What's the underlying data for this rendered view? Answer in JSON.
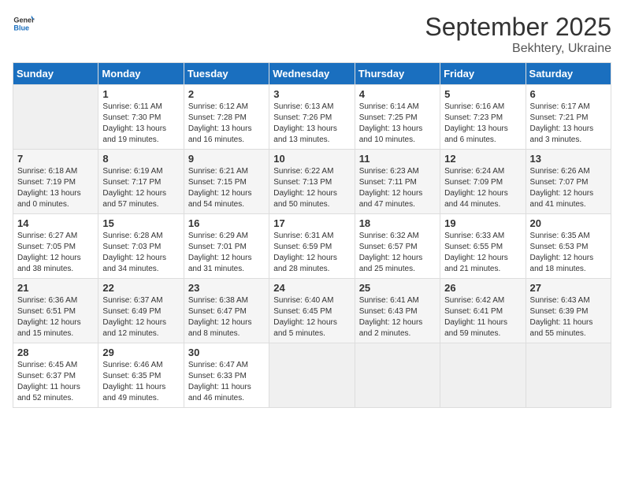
{
  "header": {
    "logo_general": "General",
    "logo_blue": "Blue",
    "month_title": "September 2025",
    "location": "Bekhtery, Ukraine"
  },
  "day_headers": [
    "Sunday",
    "Monday",
    "Tuesday",
    "Wednesday",
    "Thursday",
    "Friday",
    "Saturday"
  ],
  "weeks": [
    [
      {
        "day": "",
        "info": ""
      },
      {
        "day": "1",
        "info": "Sunrise: 6:11 AM\nSunset: 7:30 PM\nDaylight: 13 hours\nand 19 minutes."
      },
      {
        "day": "2",
        "info": "Sunrise: 6:12 AM\nSunset: 7:28 PM\nDaylight: 13 hours\nand 16 minutes."
      },
      {
        "day": "3",
        "info": "Sunrise: 6:13 AM\nSunset: 7:26 PM\nDaylight: 13 hours\nand 13 minutes."
      },
      {
        "day": "4",
        "info": "Sunrise: 6:14 AM\nSunset: 7:25 PM\nDaylight: 13 hours\nand 10 minutes."
      },
      {
        "day": "5",
        "info": "Sunrise: 6:16 AM\nSunset: 7:23 PM\nDaylight: 13 hours\nand 6 minutes."
      },
      {
        "day": "6",
        "info": "Sunrise: 6:17 AM\nSunset: 7:21 PM\nDaylight: 13 hours\nand 3 minutes."
      }
    ],
    [
      {
        "day": "7",
        "info": "Sunrise: 6:18 AM\nSunset: 7:19 PM\nDaylight: 13 hours\nand 0 minutes."
      },
      {
        "day": "8",
        "info": "Sunrise: 6:19 AM\nSunset: 7:17 PM\nDaylight: 12 hours\nand 57 minutes."
      },
      {
        "day": "9",
        "info": "Sunrise: 6:21 AM\nSunset: 7:15 PM\nDaylight: 12 hours\nand 54 minutes."
      },
      {
        "day": "10",
        "info": "Sunrise: 6:22 AM\nSunset: 7:13 PM\nDaylight: 12 hours\nand 50 minutes."
      },
      {
        "day": "11",
        "info": "Sunrise: 6:23 AM\nSunset: 7:11 PM\nDaylight: 12 hours\nand 47 minutes."
      },
      {
        "day": "12",
        "info": "Sunrise: 6:24 AM\nSunset: 7:09 PM\nDaylight: 12 hours\nand 44 minutes."
      },
      {
        "day": "13",
        "info": "Sunrise: 6:26 AM\nSunset: 7:07 PM\nDaylight: 12 hours\nand 41 minutes."
      }
    ],
    [
      {
        "day": "14",
        "info": "Sunrise: 6:27 AM\nSunset: 7:05 PM\nDaylight: 12 hours\nand 38 minutes."
      },
      {
        "day": "15",
        "info": "Sunrise: 6:28 AM\nSunset: 7:03 PM\nDaylight: 12 hours\nand 34 minutes."
      },
      {
        "day": "16",
        "info": "Sunrise: 6:29 AM\nSunset: 7:01 PM\nDaylight: 12 hours\nand 31 minutes."
      },
      {
        "day": "17",
        "info": "Sunrise: 6:31 AM\nSunset: 6:59 PM\nDaylight: 12 hours\nand 28 minutes."
      },
      {
        "day": "18",
        "info": "Sunrise: 6:32 AM\nSunset: 6:57 PM\nDaylight: 12 hours\nand 25 minutes."
      },
      {
        "day": "19",
        "info": "Sunrise: 6:33 AM\nSunset: 6:55 PM\nDaylight: 12 hours\nand 21 minutes."
      },
      {
        "day": "20",
        "info": "Sunrise: 6:35 AM\nSunset: 6:53 PM\nDaylight: 12 hours\nand 18 minutes."
      }
    ],
    [
      {
        "day": "21",
        "info": "Sunrise: 6:36 AM\nSunset: 6:51 PM\nDaylight: 12 hours\nand 15 minutes."
      },
      {
        "day": "22",
        "info": "Sunrise: 6:37 AM\nSunset: 6:49 PM\nDaylight: 12 hours\nand 12 minutes."
      },
      {
        "day": "23",
        "info": "Sunrise: 6:38 AM\nSunset: 6:47 PM\nDaylight: 12 hours\nand 8 minutes."
      },
      {
        "day": "24",
        "info": "Sunrise: 6:40 AM\nSunset: 6:45 PM\nDaylight: 12 hours\nand 5 minutes."
      },
      {
        "day": "25",
        "info": "Sunrise: 6:41 AM\nSunset: 6:43 PM\nDaylight: 12 hours\nand 2 minutes."
      },
      {
        "day": "26",
        "info": "Sunrise: 6:42 AM\nSunset: 6:41 PM\nDaylight: 11 hours\nand 59 minutes."
      },
      {
        "day": "27",
        "info": "Sunrise: 6:43 AM\nSunset: 6:39 PM\nDaylight: 11 hours\nand 55 minutes."
      }
    ],
    [
      {
        "day": "28",
        "info": "Sunrise: 6:45 AM\nSunset: 6:37 PM\nDaylight: 11 hours\nand 52 minutes."
      },
      {
        "day": "29",
        "info": "Sunrise: 6:46 AM\nSunset: 6:35 PM\nDaylight: 11 hours\nand 49 minutes."
      },
      {
        "day": "30",
        "info": "Sunrise: 6:47 AM\nSunset: 6:33 PM\nDaylight: 11 hours\nand 46 minutes."
      },
      {
        "day": "",
        "info": ""
      },
      {
        "day": "",
        "info": ""
      },
      {
        "day": "",
        "info": ""
      },
      {
        "day": "",
        "info": ""
      }
    ]
  ]
}
